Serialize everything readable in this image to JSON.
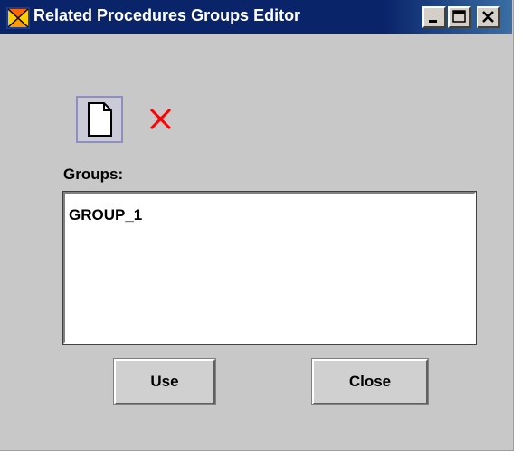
{
  "window": {
    "title": "Related Procedures Groups Editor",
    "controls": {
      "minimize": "minimize-icon",
      "maximize": "maximize-icon",
      "close": "close-icon"
    }
  },
  "toolbar": {
    "new_icon": "new-document-icon",
    "delete_icon": "delete-x-icon",
    "delete_color": "#ff0000"
  },
  "groups": {
    "label": "Groups:",
    "items": [
      "GROUP_1"
    ]
  },
  "buttons": {
    "use_label": "Use",
    "close_label": "Close"
  }
}
